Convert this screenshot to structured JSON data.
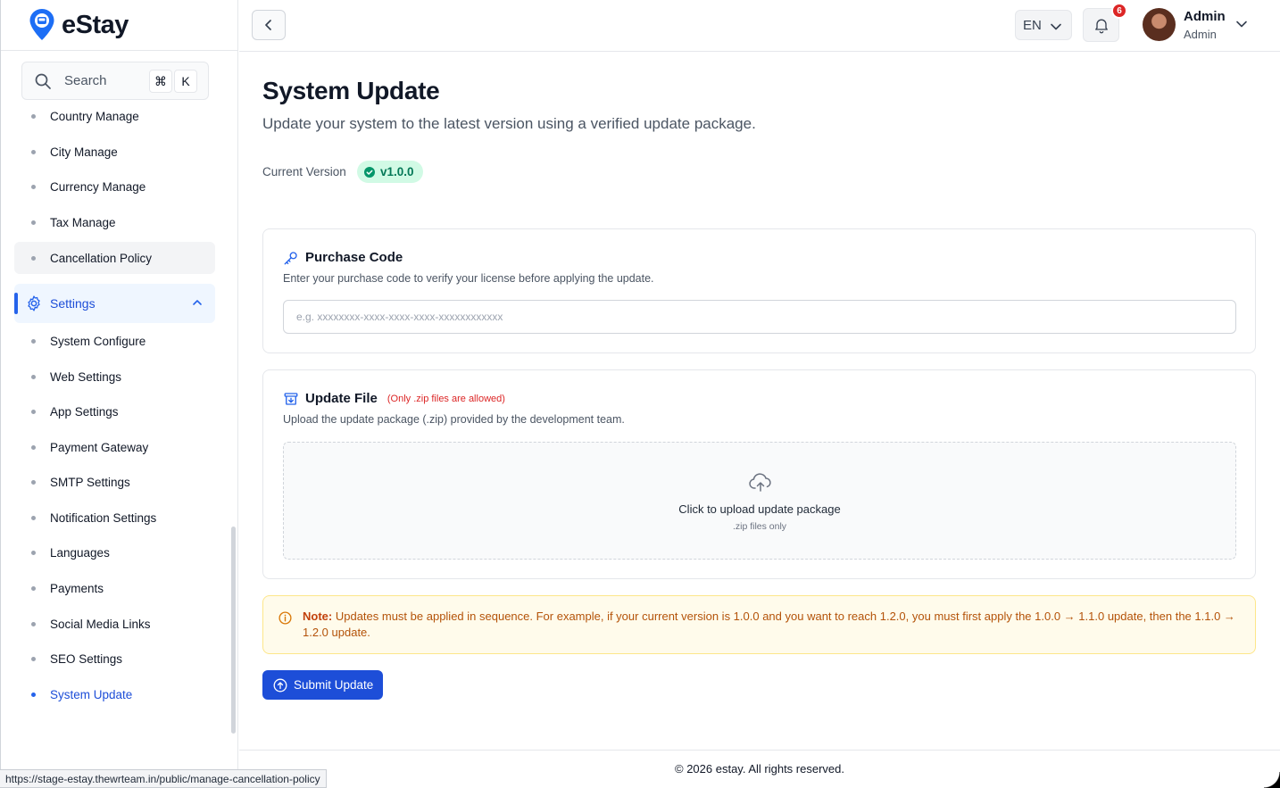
{
  "brand": {
    "name": "eStay"
  },
  "search": {
    "label": "Search",
    "kbd_cmd": "⌘",
    "kbd_k": "K"
  },
  "sidebar": {
    "items_top": [
      {
        "label": "Country Manage"
      },
      {
        "label": "City Manage"
      },
      {
        "label": "Currency Manage"
      },
      {
        "label": "Tax Manage"
      },
      {
        "label": "Cancellation Policy"
      }
    ],
    "group": {
      "label": "Settings"
    },
    "settings_items": [
      {
        "label": "System Configure"
      },
      {
        "label": "Web Settings"
      },
      {
        "label": "App Settings"
      },
      {
        "label": "Payment Gateway"
      },
      {
        "label": "SMTP Settings"
      },
      {
        "label": "Notification Settings"
      },
      {
        "label": "Languages"
      },
      {
        "label": "Payments"
      },
      {
        "label": "Social Media Links"
      },
      {
        "label": "SEO Settings"
      },
      {
        "label": "System Update"
      }
    ]
  },
  "header": {
    "language": "EN",
    "notification_count": "6",
    "user_name": "Admin",
    "user_role": "Admin"
  },
  "page": {
    "title": "System Update",
    "subtitle": "Update your system to the latest version using a verified update package.",
    "current_version_label": "Current Version",
    "current_version": "v1.0.0"
  },
  "purchase_code": {
    "title": "Purchase Code",
    "description": "Enter your purchase code to verify your license before applying the update.",
    "placeholder": "e.g. xxxxxxxx-xxxx-xxxx-xxxx-xxxxxxxxxxxx"
  },
  "update_file": {
    "title": "Update File",
    "note": "(Only .zip files are allowed)",
    "description": "Upload the update package (.zip) provided by the development team.",
    "dropzone_title": "Click to upload update package",
    "dropzone_sub": ".zip files only"
  },
  "note": {
    "label": "Note:",
    "text": "Updates must be applied in sequence. For example, if your current version is 1.0.0 and you want to reach 1.2.0, you must first apply the 1.0.0 → 1.1.0 update, then the 1.1.0 → 1.2.0 update."
  },
  "submit": {
    "label": "Submit Update"
  },
  "footer": {
    "text": "© 2026 estay. All rights reserved."
  },
  "status_bar": {
    "url": "https://stage-estay.thewrteam.in/public/manage-cancellation-policy"
  },
  "colors": {
    "primary": "#1d4ed8",
    "success_bg": "#d1fae5",
    "success": "#047857",
    "warning_bg": "#fffbeb",
    "warning": "#b45309",
    "danger": "#dc2626"
  }
}
